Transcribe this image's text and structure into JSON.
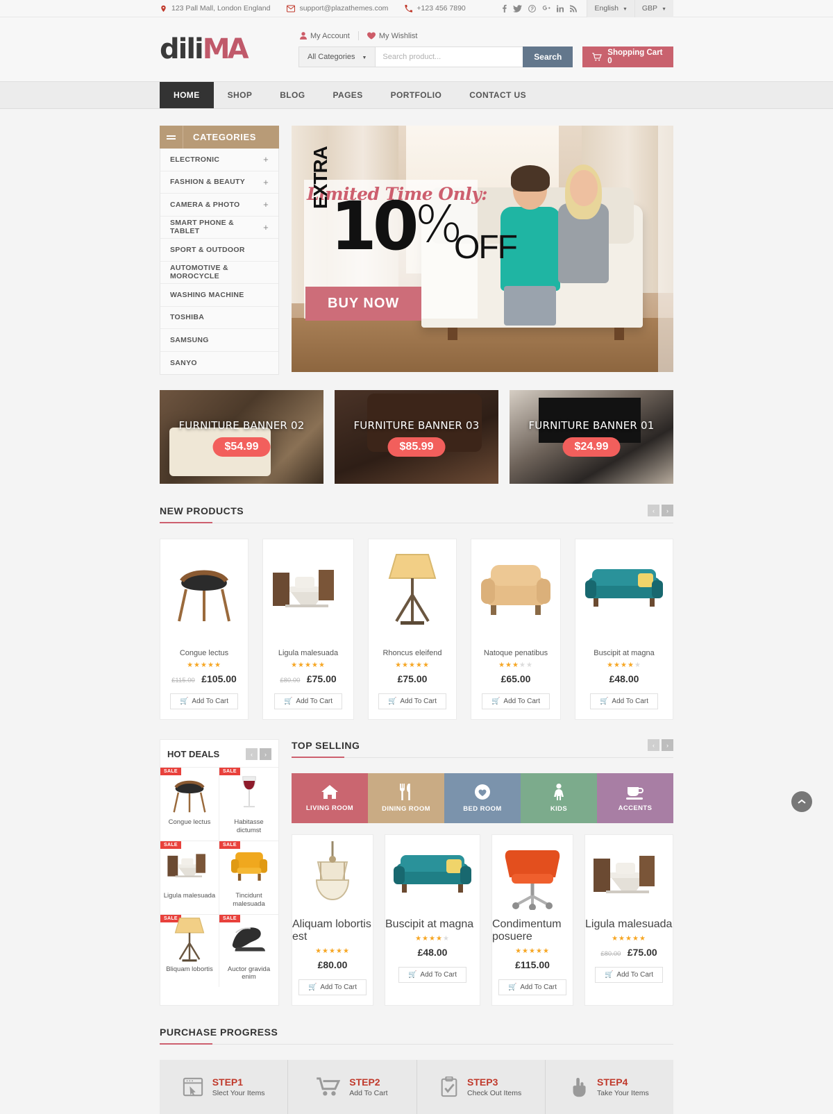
{
  "topbar": {
    "address": "123 Pall Mall, London England",
    "email": "support@plazathemes.com",
    "phone": "+123 456 7890",
    "socials": [
      "facebook-icon",
      "twitter-icon",
      "pinterest-icon",
      "google-plus-icon",
      "linkedin-icon",
      "rss-icon"
    ],
    "language": "English",
    "currency": "GBP"
  },
  "header": {
    "logo_dark": "dili",
    "logo_accent": "MA",
    "my_account": "My Account",
    "my_wishlist": "My Wishlist",
    "categories_select": "All Categories",
    "search_placeholder": "Search product...",
    "search_value": "",
    "search_button": "Search",
    "cart_label": "Shopping Cart 0"
  },
  "nav": {
    "items": [
      {
        "label": "HOME",
        "active": true
      },
      {
        "label": "SHOP",
        "active": false
      },
      {
        "label": "BLOG",
        "active": false
      },
      {
        "label": "PAGES",
        "active": false
      },
      {
        "label": "PORTFOLIO",
        "active": false
      },
      {
        "label": "CONTACT US",
        "active": false
      }
    ]
  },
  "categories": {
    "title": "CATEGORIES",
    "items": [
      {
        "label": "ELECTRONIC",
        "expandable": "+"
      },
      {
        "label": "FASHION & BEAUTY",
        "expandable": "+"
      },
      {
        "label": "CAMERA & PHOTO",
        "expandable": "+"
      },
      {
        "label": "SMART PHONE & TABLET",
        "expandable": "+"
      },
      {
        "label": "SPORT & OUTDOOR",
        "expandable": ""
      },
      {
        "label": "AUTOMOTIVE & MOROCYCLE",
        "expandable": ""
      },
      {
        "label": "WASHING MACHINE",
        "expandable": ""
      },
      {
        "label": "TOSHIBA",
        "expandable": ""
      },
      {
        "label": "SAMSUNG",
        "expandable": ""
      },
      {
        "label": "SANYO",
        "expandable": ""
      }
    ]
  },
  "hero": {
    "eyebrow": "Limited Time Only:",
    "extra": "EXTRA",
    "number": "10",
    "percent": "%",
    "off": "OFF",
    "cta": "BUY NOW"
  },
  "banners": [
    {
      "label": "FURNITURE BANNER 02",
      "price": "$54.99"
    },
    {
      "label": "FURNITURE BANNER 03",
      "price": "$85.99"
    },
    {
      "label": "FURNITURE BANNER 01",
      "price": "$24.99"
    }
  ],
  "new_products": {
    "title": "NEW PRODUCTS",
    "prev": "‹",
    "next": "›",
    "add_to_cart": "Add To Cart",
    "items": [
      {
        "name": "Congue lectus",
        "rating": 5,
        "old_price": "£115.00",
        "price": "£105.00"
      },
      {
        "name": "Ligula malesuada",
        "rating": 5,
        "old_price": "£80.00",
        "price": "£75.00"
      },
      {
        "name": "Rhoncus eleifend",
        "rating": 5,
        "old_price": "",
        "price": "£75.00"
      },
      {
        "name": "Natoque penatibus",
        "rating": 3,
        "old_price": "",
        "price": "£65.00"
      },
      {
        "name": "Buscipit at magna",
        "rating": 4,
        "old_price": "",
        "price": "£48.00"
      }
    ]
  },
  "hot_deals": {
    "title": "HOT DEALS",
    "prev": "‹",
    "next": "›",
    "sale_tag": "SALE",
    "items": [
      {
        "name": "Congue lectus"
      },
      {
        "name": "Habitasse dictumst"
      },
      {
        "name": "Ligula malesuada"
      },
      {
        "name": "Tincidunt malesuada"
      },
      {
        "name": "Bliquam lobortis"
      },
      {
        "name": "Auctor gravida enim"
      }
    ]
  },
  "top_selling": {
    "title": "TOP SELLING",
    "prev": "‹",
    "next": "›",
    "add_to_cart": "Add To Cart",
    "tabs": [
      {
        "label": "LIVING ROOM",
        "icon": "home-icon",
        "color": "#ca6670",
        "active": true
      },
      {
        "label": "DINING ROOM",
        "icon": "cutlery-icon",
        "color": "#c9ab84",
        "active": false
      },
      {
        "label": "BED ROOM",
        "icon": "heart-circle-icon",
        "color": "#7b93ac",
        "active": false
      },
      {
        "label": "KIDS",
        "icon": "child-icon",
        "color": "#7cab8c",
        "active": false
      },
      {
        "label": "ACCENTS",
        "icon": "coffee-cup-icon",
        "color": "#a87ea4",
        "active": false
      }
    ],
    "items": [
      {
        "name": "Aliquam lobortis est",
        "rating": 5,
        "old_price": "",
        "price": "£80.00"
      },
      {
        "name": "Buscipit at magna",
        "rating": 4,
        "old_price": "",
        "price": "£48.00"
      },
      {
        "name": "Condimentum posuere",
        "rating": 5,
        "old_price": "",
        "price": "£115.00"
      },
      {
        "name": "Ligula malesuada",
        "rating": 5,
        "old_price": "£80.00",
        "price": "£75.00"
      }
    ]
  },
  "purchase_progress": {
    "title": "PURCHASE PROGRESS",
    "steps": [
      {
        "step": "STEP1",
        "desc": "Slect Your Items",
        "icon": "window-cursor-icon"
      },
      {
        "step": "STEP2",
        "desc": "Add To Cart",
        "icon": "cart-icon"
      },
      {
        "step": "STEP3",
        "desc": "Check Out Items",
        "icon": "clipboard-check-icon"
      },
      {
        "step": "STEP4",
        "desc": "Take Your Items",
        "icon": "hand-pointer-icon"
      }
    ]
  },
  "scroll_top": "⌃",
  "colors": {
    "accent_red": "#cd5f6e",
    "cart_red": "#c9626e",
    "search_blue": "#63778c",
    "category_tan": "#b89b77",
    "price_badge": "#f25f5c",
    "sale_tag": "#e8413c",
    "star_gold": "#f6a623"
  }
}
